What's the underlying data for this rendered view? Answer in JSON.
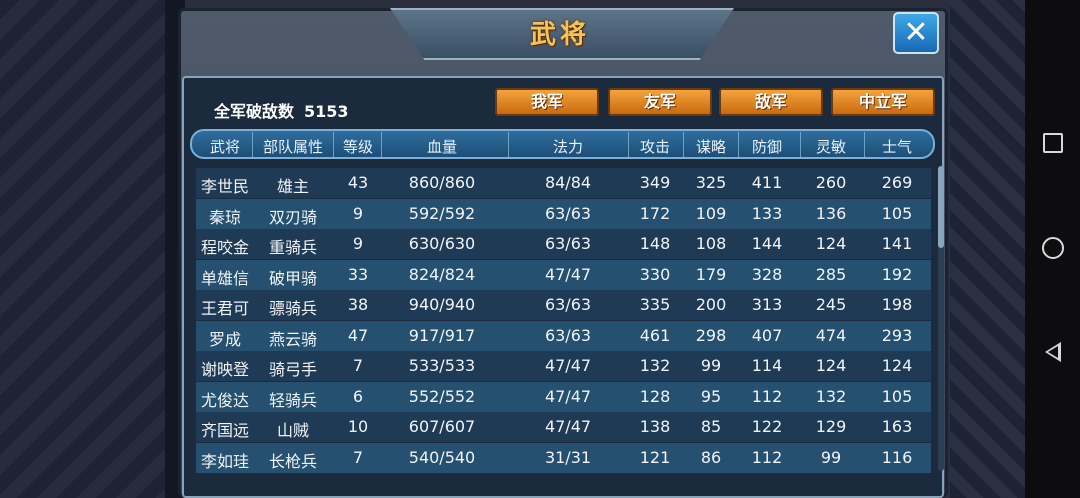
{
  "title": "武将",
  "kills": {
    "label": "全军破敌数",
    "value": "5153"
  },
  "tabs": [
    "我军",
    "友军",
    "敌军",
    "中立军"
  ],
  "columns": [
    "武将",
    "部队属性",
    "等级",
    "血量",
    "法力",
    "攻击",
    "谋略",
    "防御",
    "灵敏",
    "士气"
  ],
  "rows": [
    [
      "李世民",
      "雄主",
      "43",
      "860/860",
      "84/84",
      "349",
      "325",
      "411",
      "260",
      "269"
    ],
    [
      "秦琼",
      "双刃骑",
      "9",
      "592/592",
      "63/63",
      "172",
      "109",
      "133",
      "136",
      "105"
    ],
    [
      "程咬金",
      "重骑兵",
      "9",
      "630/630",
      "63/63",
      "148",
      "108",
      "144",
      "124",
      "141"
    ],
    [
      "单雄信",
      "破甲骑",
      "33",
      "824/824",
      "47/47",
      "330",
      "179",
      "328",
      "285",
      "192"
    ],
    [
      "王君可",
      "骠骑兵",
      "38",
      "940/940",
      "63/63",
      "335",
      "200",
      "313",
      "245",
      "198"
    ],
    [
      "罗成",
      "燕云骑",
      "47",
      "917/917",
      "63/63",
      "461",
      "298",
      "407",
      "474",
      "293"
    ],
    [
      "谢映登",
      "骑弓手",
      "7",
      "533/533",
      "47/47",
      "132",
      "99",
      "114",
      "124",
      "124"
    ],
    [
      "尤俊达",
      "轻骑兵",
      "6",
      "552/552",
      "47/47",
      "128",
      "95",
      "112",
      "132",
      "105"
    ],
    [
      "齐国远",
      "山贼",
      "10",
      "607/607",
      "47/47",
      "138",
      "85",
      "122",
      "129",
      "163"
    ],
    [
      "李如珪",
      "长枪兵",
      "7",
      "540/540",
      "31/31",
      "121",
      "86",
      "112",
      "99",
      "116"
    ]
  ],
  "close_icon": "close-x-icon",
  "colors": {
    "title": "#f3c45b",
    "tab": "#e08a25",
    "close": "#2a88d0"
  }
}
